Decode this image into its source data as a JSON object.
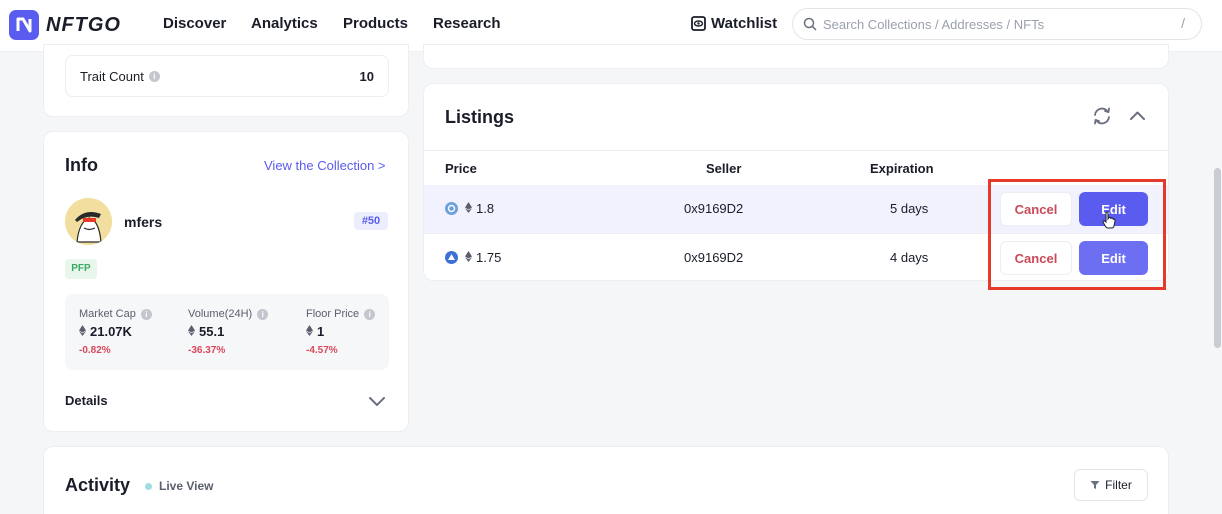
{
  "brand": {
    "name": "NFTGO",
    "accent": "#5a5cf0"
  },
  "nav": {
    "items": [
      {
        "label": "Discover"
      },
      {
        "label": "Analytics"
      },
      {
        "label": "Products"
      },
      {
        "label": "Research"
      }
    ],
    "watchlist": "Watchlist",
    "search_placeholder": "Search Collections / Addresses / NFTs",
    "search_shortcut": "/"
  },
  "trait": {
    "label": "Trait Count",
    "value": "10"
  },
  "info": {
    "title": "Info",
    "view_link": "View the Collection >",
    "collection_name": "mfers",
    "rank": "#50",
    "tag": "PFP",
    "stats": [
      {
        "label": "Market Cap",
        "value": "21.07K",
        "change": "-0.82%"
      },
      {
        "label": "Volume(24H)",
        "value": "55.1",
        "change": "-36.37%"
      },
      {
        "label": "Floor Price",
        "value": "1",
        "change": "-4.57%"
      }
    ],
    "details_label": "Details"
  },
  "listings": {
    "title": "Listings",
    "headers": {
      "price": "Price",
      "seller": "Seller",
      "expiration": "Expiration"
    },
    "rows": [
      {
        "price": "1.8",
        "seller": "0x9169D2",
        "expiration": "5 days",
        "cancel": "Cancel",
        "edit": "Edit"
      },
      {
        "price": "1.75",
        "seller": "0x9169D2",
        "expiration": "4 days",
        "cancel": "Cancel",
        "edit": "Edit"
      }
    ],
    "highlight_color": "#e53a2a"
  },
  "activity": {
    "title": "Activity",
    "live_label": "Live View",
    "filter_label": "Filter"
  }
}
